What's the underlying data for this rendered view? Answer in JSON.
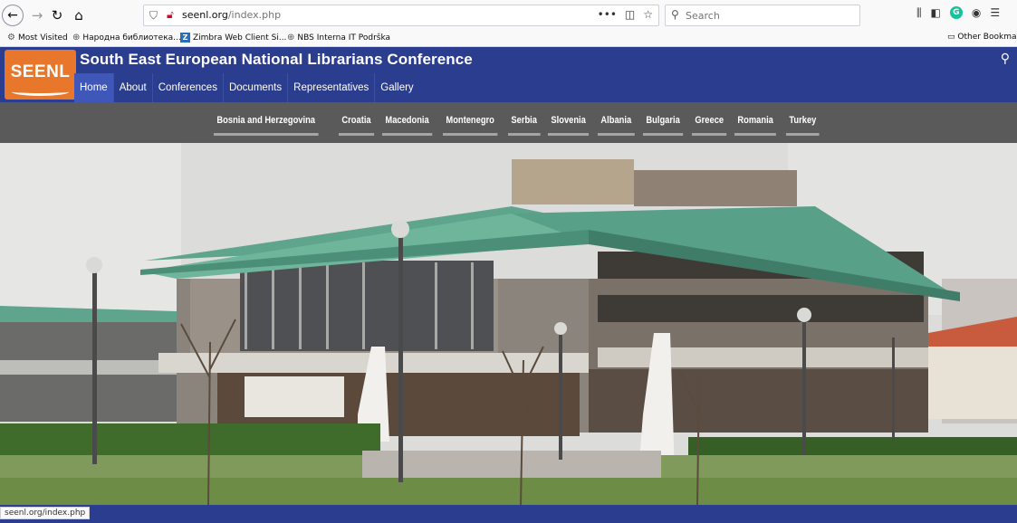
{
  "browser": {
    "url_host": "seenl.org",
    "url_path": "/index.php",
    "search_placeholder": "Search",
    "status_url": "seenl.org/index.php"
  },
  "bookmarks": {
    "items": [
      "Most Visited",
      "Народна библиотека...",
      "Zimbra Web Client Si...",
      "NBS Interna IT Podrška"
    ],
    "other": "Other Bookmarks"
  },
  "site": {
    "logo_text": "SEENL",
    "title": "South East European National Librarians Conference",
    "nav": [
      "Home",
      "About",
      "Conferences",
      "Documents",
      "Representatives",
      "Gallery"
    ],
    "active_nav": "Home",
    "countries": [
      "Bosnia and Herzegovina",
      "Croatia",
      "Macedonia",
      "Montenegro",
      "Serbia",
      "Slovenia",
      "Albania",
      "Bulgaria",
      "Greece",
      "Romania",
      "Turkey"
    ]
  },
  "colors": {
    "header_blue": "#2a3d8f",
    "logo_orange": "#e8772b",
    "country_bar": "#5a5a5a",
    "roof_green": "#5fa58d"
  },
  "icons": {
    "back": "arrow-left-icon",
    "forward": "arrow-right-icon",
    "reload": "reload-icon",
    "home": "home-icon",
    "search": "search-icon"
  }
}
